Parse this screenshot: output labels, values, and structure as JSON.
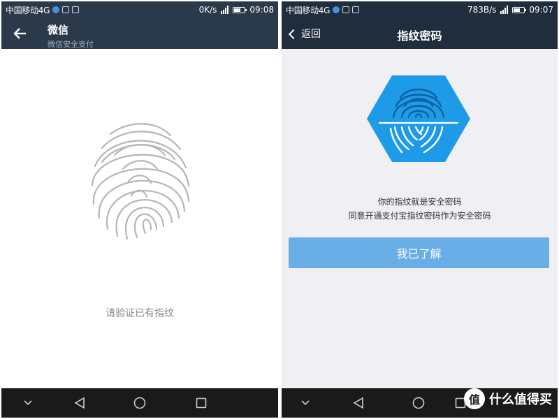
{
  "left": {
    "status": {
      "carrier": "中国移动4G",
      "speed": "0K/s",
      "time": "09:08"
    },
    "header": {
      "title": "微信",
      "subtitle": "微信安全支付"
    },
    "body": {
      "prompt": "请验证已有指纹"
    }
  },
  "right": {
    "status": {
      "carrier": "中国移动4G",
      "speed": "783B/s",
      "time": "09:07"
    },
    "header": {
      "back_label": "返回",
      "title": "指纹密码"
    },
    "body": {
      "line1": "你的指纹就是安全密码",
      "line2": "同意开通支付宝指纹密码作为安全密码",
      "button_label": "我已了解"
    }
  },
  "watermark": {
    "text": "什么值得买",
    "badge": "值"
  },
  "colors": {
    "dark_header_left": "#2b3a4a",
    "dark_header_right": "#1f2d3d",
    "accent_blue": "#1e9be8",
    "button_blue": "#6aaee8",
    "nav_bg": "#1a1a1a"
  }
}
